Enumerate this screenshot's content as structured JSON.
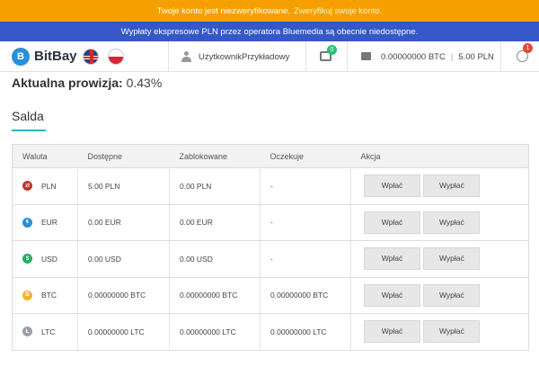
{
  "banner_warning": {
    "text": "Twoje konto jest niezweryfikowane.",
    "link": "Zweryfikuj swoje konto."
  },
  "banner_info": {
    "text": "Wypłaty ekspresowe PLN przez operatora Bluemedia są obecnie niedostępne."
  },
  "navbar": {
    "logo_text": "BitBay",
    "logo_icon": "B",
    "username": "UżytkownikPrzykładowy",
    "notif_count": "0",
    "balance_btc": "0.00000000 BTC",
    "balance_divider": "|",
    "balance_pln": "5.00 PLN",
    "alert_count": "1"
  },
  "commission": {
    "label": "Aktualna prowizja:",
    "value": "0.43%"
  },
  "section_title": "Salda",
  "table": {
    "headers": {
      "currency": "Waluta",
      "available": "Dostępne",
      "locked": "Zablokowane",
      "pending": "Oczekuje",
      "action": "Akcja"
    },
    "deposit_label": "Wpłać",
    "withdraw_label": "Wypłać",
    "rows": [
      {
        "code": "PLN",
        "symbol": "zł",
        "color": "#c0392b",
        "available": "5.00 PLN",
        "locked": "0.00 PLN",
        "pending": "-"
      },
      {
        "code": "EUR",
        "symbol": "€",
        "color": "#2a8fd6",
        "available": "0.00 EUR",
        "locked": "0.00 EUR",
        "pending": "-"
      },
      {
        "code": "USD",
        "symbol": "$",
        "color": "#27ae60",
        "available": "0.00 USD",
        "locked": "0.00 USD",
        "pending": "-"
      },
      {
        "code": "BTC",
        "symbol": "B",
        "color": "#f0b429",
        "available": "0.00000000 BTC",
        "locked": "0.00000000 BTC",
        "pending": "0.00000000 BTC"
      },
      {
        "code": "LTC",
        "symbol": "Ł",
        "color": "#9aa0a6",
        "available": "0.00000000 LTC",
        "locked": "0.00000000 LTC",
        "pending": "0.00000000 LTC"
      }
    ]
  }
}
